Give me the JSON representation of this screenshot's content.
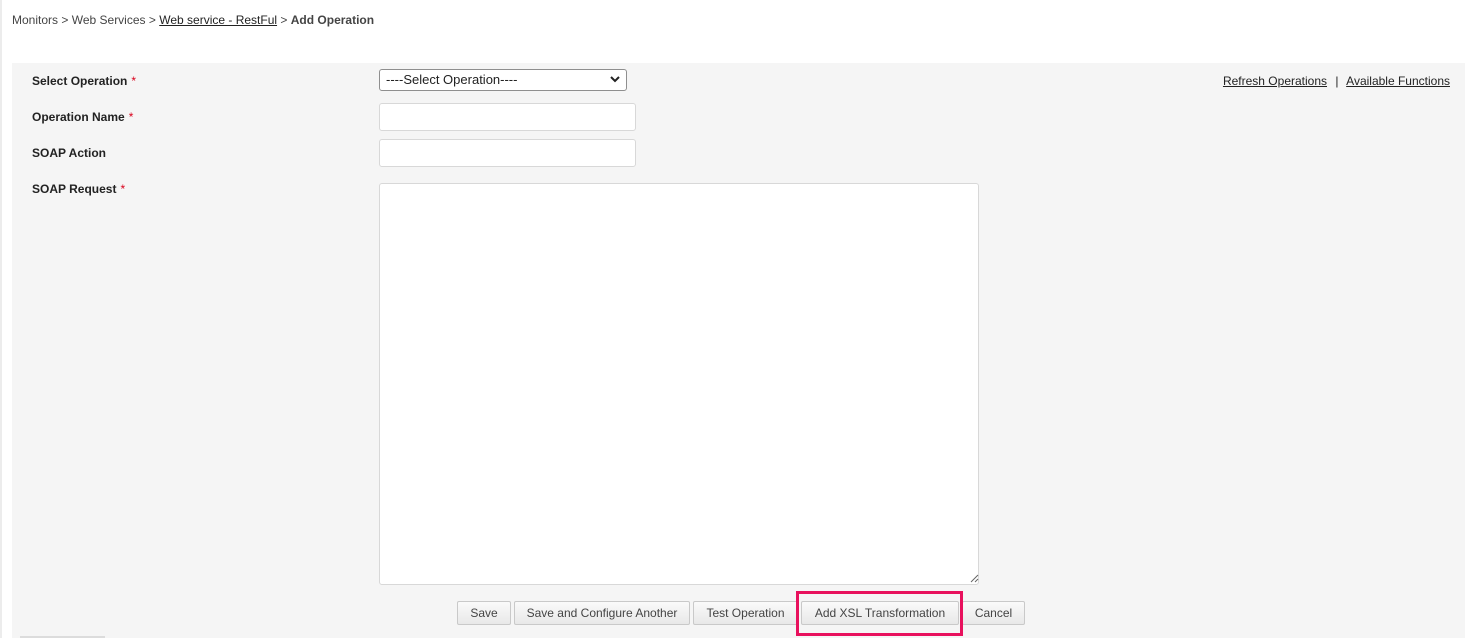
{
  "breadcrumb": {
    "item1": "Monitors",
    "sep": ">",
    "item2": "Web Services",
    "item3": "Web service - RestFul",
    "current": "Add Operation"
  },
  "form": {
    "select_operation_label": "Select Operation",
    "select_operation_value": "----Select Operation----",
    "operation_name_label": "Operation Name",
    "operation_name_value": "",
    "soap_action_label": "SOAP Action",
    "soap_action_value": "",
    "soap_request_label": "SOAP Request",
    "soap_request_value": "",
    "required_marker": "*"
  },
  "links": {
    "refresh_operations": "Refresh Operations",
    "separator": "|",
    "available_functions": "Available Functions"
  },
  "buttons": {
    "save": "Save",
    "save_and_configure_another": "Save and Configure Another",
    "test_operation": "Test Operation",
    "add_xsl_transformation": "Add XSL Transformation",
    "cancel": "Cancel"
  },
  "colors": {
    "highlight": "#e8115d",
    "required": "#d9001b",
    "panel_background": "#f5f5f5"
  }
}
